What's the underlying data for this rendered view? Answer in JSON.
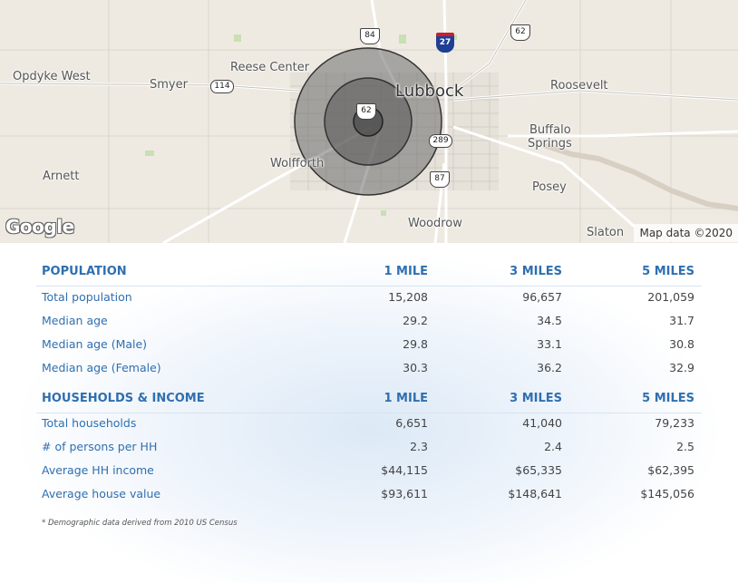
{
  "map": {
    "places": {
      "opdyke_west": "Opdyke West",
      "smyer": "Smyer",
      "reese_center": "Reese Center",
      "lubbock": "Lubbock",
      "roosevelt": "Roosevelt",
      "buffalo_springs_1": "Buffalo",
      "buffalo_springs_2": "Springs",
      "arnett": "Arnett",
      "wolfforth": "Wolfforth",
      "posey": "Posey",
      "woodrow": "Woodrow",
      "slaton": "Slaton"
    },
    "routes": {
      "us84": "84",
      "i27": "27",
      "us62_east": "62",
      "tx114": "114",
      "us62_center": "62",
      "loop289": "289",
      "us87": "87"
    },
    "logo_text": "Google",
    "credit": "Map data ©2020"
  },
  "columns": [
    "1 MILE",
    "3 MILES",
    "5 MILES"
  ],
  "population": {
    "heading": "POPULATION",
    "rows": [
      {
        "label": "Total population",
        "values": [
          "15,208",
          "96,657",
          "201,059"
        ]
      },
      {
        "label": "Median age",
        "values": [
          "29.2",
          "34.5",
          "31.7"
        ]
      },
      {
        "label": "Median age (Male)",
        "values": [
          "29.8",
          "33.1",
          "30.8"
        ]
      },
      {
        "label": "Median age (Female)",
        "values": [
          "30.3",
          "36.2",
          "32.9"
        ]
      }
    ]
  },
  "households": {
    "heading": "HOUSEHOLDS & INCOME",
    "rows": [
      {
        "label": "Total households",
        "values": [
          "6,651",
          "41,040",
          "79,233"
        ]
      },
      {
        "label": "# of persons per HH",
        "values": [
          "2.3",
          "2.4",
          "2.5"
        ]
      },
      {
        "label": "Average HH income",
        "values": [
          "$44,115",
          "$65,335",
          "$62,395"
        ]
      },
      {
        "label": "Average house value",
        "values": [
          "$93,611",
          "$148,641",
          "$145,056"
        ]
      }
    ]
  },
  "footnote": "* Demographic data derived from 2010 US Census",
  "colors": {
    "accent_blue": "#2f6fb0",
    "map_background": "#eeeae2",
    "radius_fill": "#555555"
  }
}
